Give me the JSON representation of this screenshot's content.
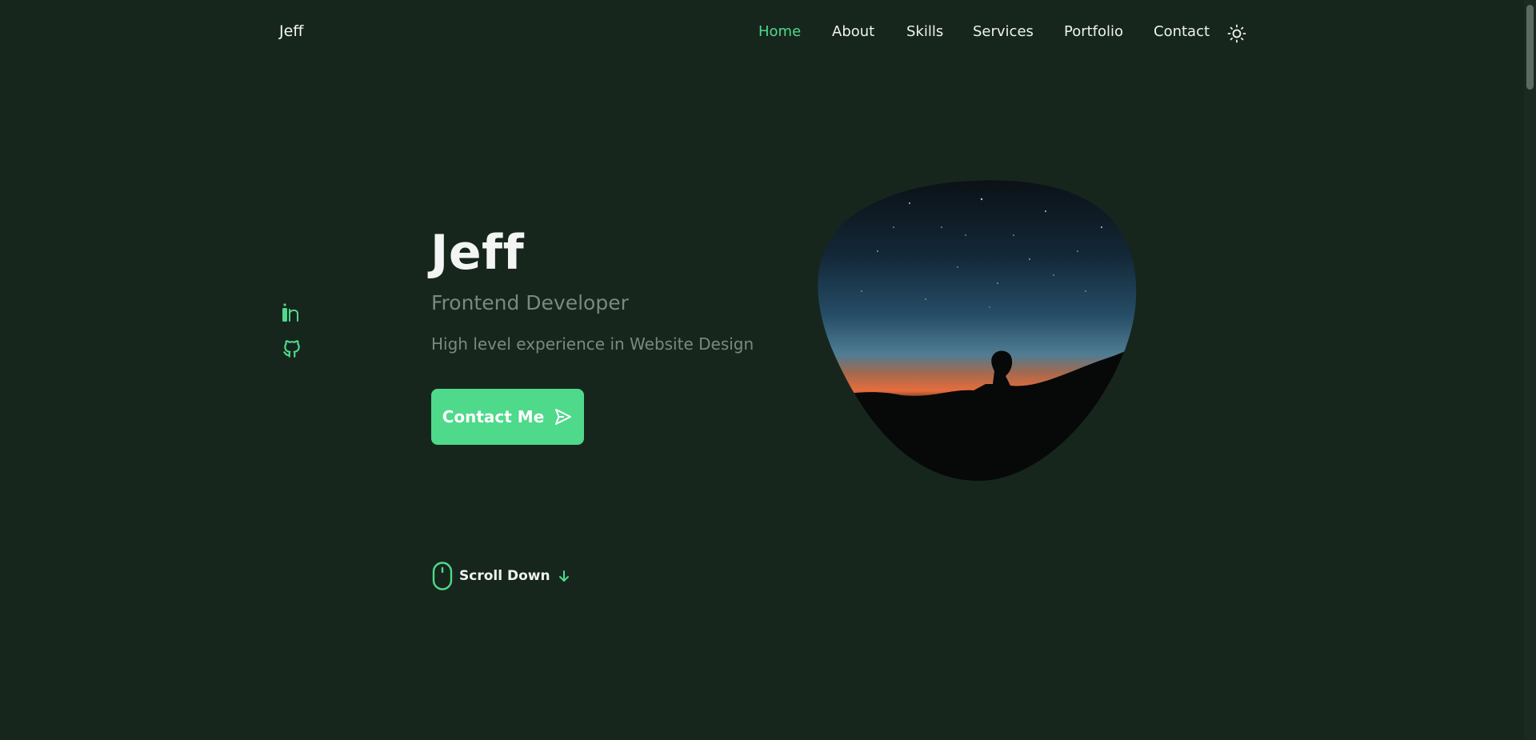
{
  "brand": "Jeff",
  "nav": {
    "items": [
      {
        "label": "Home",
        "active": true
      },
      {
        "label": "About",
        "active": false
      },
      {
        "label": "Skills",
        "active": false
      },
      {
        "label": "Services",
        "active": false
      },
      {
        "label": "Portfolio",
        "active": false
      },
      {
        "label": "Contact",
        "active": false
      }
    ],
    "theme_toggle_icon": "sun-icon"
  },
  "social": [
    {
      "icon": "linkedin-icon"
    },
    {
      "icon": "github-icon"
    }
  ],
  "hero": {
    "name": "Jeff",
    "role": "Frontend Developer",
    "description": "High level experience in Website Design",
    "contact_button": {
      "label": "Contact Me",
      "icon": "send-icon"
    },
    "image": {
      "subject": "silhouette of a person under a starry night sky at sunset",
      "icon": "hero-image"
    }
  },
  "scroll": {
    "label": "Scroll Down",
    "mouse_icon": "mouse-icon",
    "arrow_icon": "arrow-down-icon"
  },
  "colors": {
    "background": "#16261d",
    "accent": "#4fd98b",
    "text": "#f1f3f2",
    "muted": "#7b8880"
  }
}
